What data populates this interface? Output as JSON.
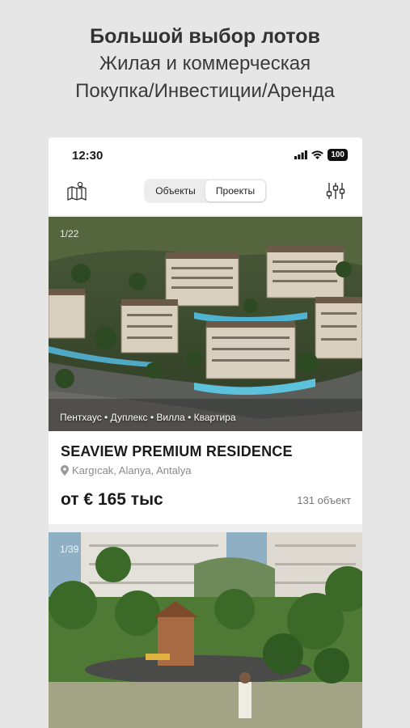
{
  "promo": {
    "title": "Большой выбор лотов",
    "line1": "Жилая и коммерческая",
    "line2": "Покупка/Инвестиции/Аренда"
  },
  "status_bar": {
    "time": "12:30",
    "battery": "100"
  },
  "app_bar": {
    "map_icon": "map-pin-icon",
    "filter_icon": "sliders-icon",
    "tabs": [
      {
        "label": "Объекты",
        "selected": false
      },
      {
        "label": "Проекты",
        "selected": true
      }
    ]
  },
  "listings": [
    {
      "image_counter": "1/22",
      "tags": "Пентхаус • Дуплекс • Вилла • Квартира",
      "title": "SEAVIEW PREMIUM RESIDENCE",
      "location": "Kargıcak, Alanya, Antalya",
      "price": "от € 165 тыс",
      "objects_count": "131 объект"
    },
    {
      "image_counter": "1/39"
    }
  ]
}
